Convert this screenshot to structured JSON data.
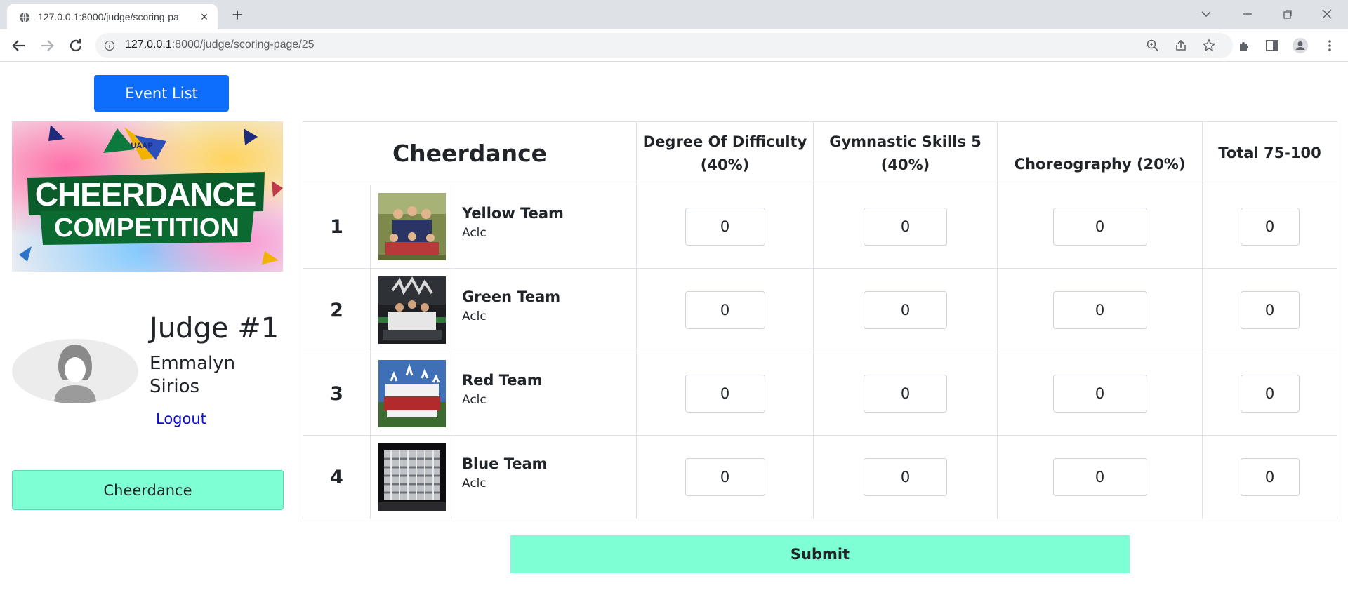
{
  "browser": {
    "tab_title": "127.0.0.1:8000/judge/scoring-pa",
    "url_host": "127.0.0.1",
    "url_rest": ":8000/judge/scoring-page/25"
  },
  "sidebar": {
    "event_list_label": "Event List",
    "banner_text_line1": "CHEERDANCE",
    "banner_text_line2": "COMPETITION",
    "banner_logo_text": "UAAP",
    "judge_title": "Judge #1",
    "judge_name": "Emmalyn Sirios",
    "logout_label": "Logout",
    "event_chip_label": "Cheerdance"
  },
  "table": {
    "event_title": "Cheerdance",
    "col_difficulty": "Degree Of Difficulty (40%)",
    "col_gymnastic": "Gymnastic Skills 5 (40%)",
    "col_choreography": "Choreography (20%)",
    "col_total": "Total 75-100",
    "rows": [
      {
        "rank": "1",
        "team": "Yellow Team",
        "sub": "Aclc",
        "difficulty": "0",
        "gymnastic": "0",
        "choreography": "0",
        "total": "0"
      },
      {
        "rank": "2",
        "team": "Green Team",
        "sub": "Aclc",
        "difficulty": "0",
        "gymnastic": "0",
        "choreography": "0",
        "total": "0"
      },
      {
        "rank": "3",
        "team": "Red Team",
        "sub": "Aclc",
        "difficulty": "0",
        "gymnastic": "0",
        "choreography": "0",
        "total": "0"
      },
      {
        "rank": "4",
        "team": "Blue Team",
        "sub": "Aclc",
        "difficulty": "0",
        "gymnastic": "0",
        "choreography": "0",
        "total": "0"
      }
    ]
  },
  "submit_label": "Submit",
  "colors": {
    "primary": "#0d6efd",
    "accent": "#7fffd4",
    "link": "#0d0dd6"
  }
}
